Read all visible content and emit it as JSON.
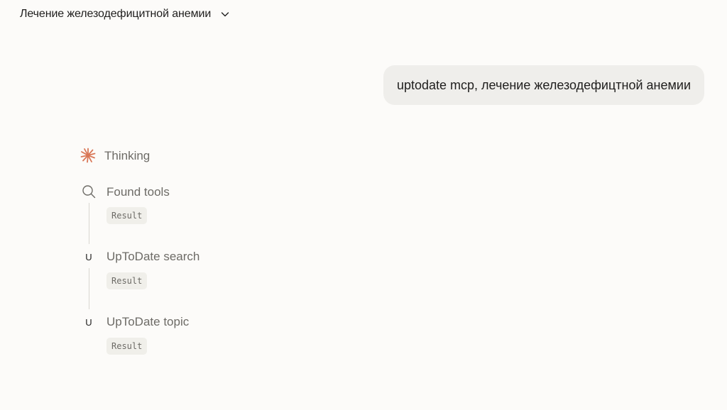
{
  "header": {
    "title": "Лечение железодефицитной анемии"
  },
  "user_message": {
    "text": "uptodate mcp, лечение железодефицтной анемии"
  },
  "steps": {
    "thinking": {
      "label": "Thinking",
      "icon": "spark-icon",
      "accent": "#d97757"
    },
    "found_tools": {
      "label": "Found tools",
      "icon": "search-icon",
      "result": "Result"
    },
    "search": {
      "label": "UpToDate search",
      "icon_letter": "U",
      "result": "Result"
    },
    "topic": {
      "label": "UpToDate topic",
      "icon_letter": "U",
      "result": "Result"
    }
  }
}
